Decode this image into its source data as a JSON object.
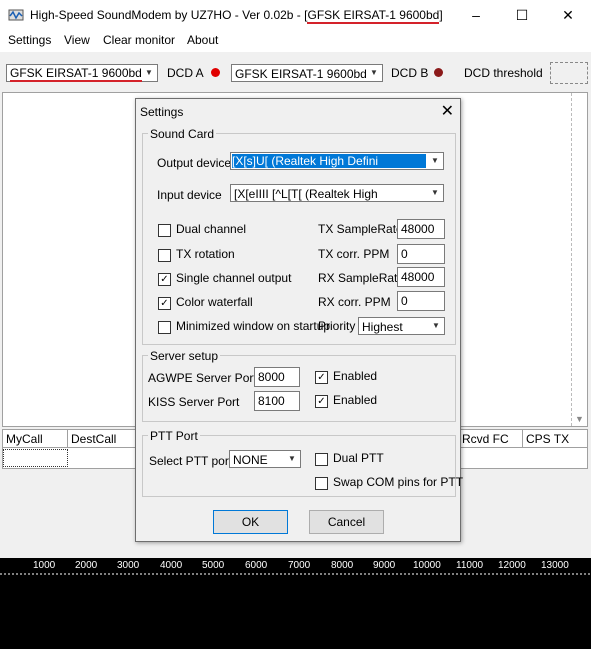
{
  "window": {
    "title_prefix": "High-Speed SoundModem by UZ7HO - Ver 0.02b - [",
    "title_mode": "GFSK EIRSAT-1 9600bd",
    "title_suffix": "]",
    "minimize": "–",
    "maximize": "☐",
    "close": "✕"
  },
  "menu": {
    "settings": "Settings",
    "view": "View",
    "clear_monitor": "Clear monitor",
    "about": "About"
  },
  "toolbar": {
    "modem_a": "GFSK EIRSAT-1 9600bd",
    "dcd_a": "DCD A",
    "modem_b": "GFSK EIRSAT-1 9600bd",
    "dcd_b": "DCD B",
    "dcd_threshold": "DCD threshold",
    "dcd_a_color": "#e00000",
    "dcd_b_color": "#8b1a1a"
  },
  "grid": {
    "headers": [
      "MyCall",
      "DestCall",
      "Rcvd FC",
      "CPS TX"
    ]
  },
  "waterfall": {
    "ticks": [
      "1000",
      "2000",
      "3000",
      "4000",
      "5000",
      "6000",
      "7000",
      "8000",
      "9000",
      "10000",
      "11000",
      "12000",
      "13000"
    ]
  },
  "dialog": {
    "title": "Settings",
    "close": "✕",
    "sound_card": {
      "group_title": "Sound Card",
      "output_label": "Output device",
      "output_value": "[X[s]U[ (Realtek High Defini",
      "input_label": "Input device",
      "input_value": "[X[eIIII [^L[T[ (Realtek High",
      "dual_channel": "Dual channel",
      "tx_rotation": "TX rotation",
      "single_channel": "Single channel output",
      "color_waterfall": "Color waterfall",
      "minimized": "Minimized window on startup",
      "tx_samplerate_label": "TX SampleRate",
      "tx_samplerate": "48000",
      "tx_ppm_label": "TX corr. PPM",
      "tx_ppm": "0",
      "rx_samplerate_label": "RX SampleRate",
      "rx_samplerate": "48000",
      "rx_ppm_label": "RX corr. PPM",
      "rx_ppm": "0",
      "priority_label": "Priority",
      "priority_value": "Highest",
      "checked_mark": "✓"
    },
    "server": {
      "group_title": "Server setup",
      "agwpe_label": "AGWPE Server Port",
      "agwpe_port": "8000",
      "kiss_label": "KISS Server Port",
      "kiss_port": "8100",
      "enabled": "Enabled"
    },
    "ptt": {
      "group_title": "PTT Port",
      "select_label": "Select PTT port",
      "port_value": "NONE",
      "dual_ptt": "Dual PTT",
      "swap_com": "Swap COM pins for PTT"
    },
    "ok": "OK",
    "cancel": "Cancel"
  }
}
